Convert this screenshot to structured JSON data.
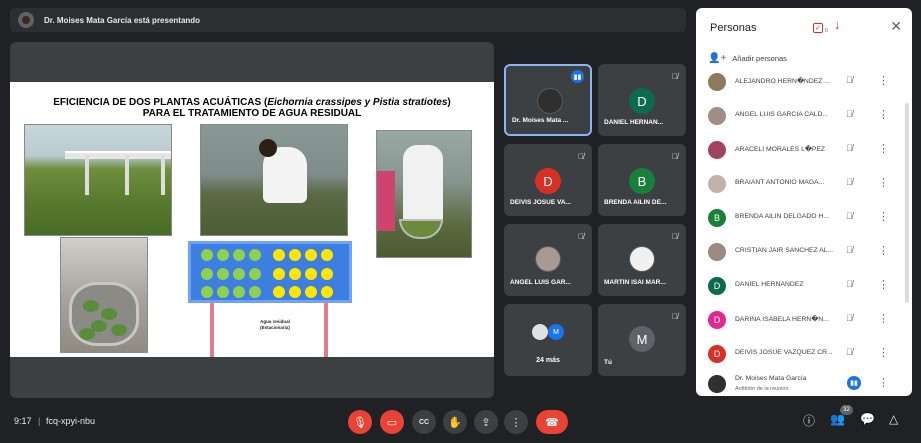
{
  "topbar": {
    "presenter_text": "Dr. Moises Mata García está presentando"
  },
  "slide": {
    "title_line1_prefix": "EFICIENCIA DE DOS PLANTAS ACUÁTICAS (",
    "title_line1_italic": "Eichornia crassipes y Pistia stratiotes",
    "title_line1_suffix": ")",
    "title_line2": "PARA EL TRATAMIENTO DE AGUA RESIDUAL",
    "diagram_label_line1": "Agua residual",
    "diagram_label_line2": "(Estacionaria)"
  },
  "tiles": [
    {
      "name": "Dr. Moises Mata ...",
      "kind": "photo",
      "status": "speaking"
    },
    {
      "name": "DANIEL HERNAN...",
      "kind": "letter",
      "letter": "D",
      "color": "#0b6b4f",
      "status": "muted"
    },
    {
      "name": "DEIVIS JOSUE VA...",
      "kind": "letter",
      "letter": "D",
      "color": "#d93025",
      "status": "muted"
    },
    {
      "name": "BRENDA AILIN DE...",
      "kind": "letter",
      "letter": "B",
      "color": "#188038",
      "status": "muted"
    },
    {
      "name": "ANGEL LUIS GAR...",
      "kind": "photo",
      "status": "muted"
    },
    {
      "name": "MARTIN ISAI MAR...",
      "kind": "photo",
      "status": "muted"
    },
    {
      "name": "24 más",
      "kind": "group",
      "status": "none"
    },
    {
      "name": "Tú",
      "kind": "letter",
      "letter": "M",
      "color": "#5f6368",
      "status": "muted"
    }
  ],
  "bottom": {
    "time": "9:17",
    "separator": "|",
    "meeting_code": "fcq-xpyi-nbu",
    "participants_badge": "32"
  },
  "people_panel": {
    "title": "Personas",
    "tasks_count": "0",
    "add_label": "Añadir personas",
    "people": [
      {
        "name": "ALEJANDRO HERN�NDEZ ...",
        "avatar": "photo",
        "letter": "",
        "color": "#8d7a5c"
      },
      {
        "name": "ANGEL LUIS GARCIA CALD...",
        "avatar": "photo",
        "letter": "",
        "color": "#9e8e86"
      },
      {
        "name": "ARACELI MORALES L�PEZ",
        "avatar": "photo",
        "letter": "",
        "color": "#a3445e"
      },
      {
        "name": "BRAIANT ANTONIO MAGA...",
        "avatar": "photo",
        "letter": "",
        "color": "#bfb3a6"
      },
      {
        "name": "BRENDA AILIN DELGADO H...",
        "avatar": "letter",
        "letter": "B",
        "color": "#188038"
      },
      {
        "name": "CRISTIAN JAIR SANCHEZ AL...",
        "avatar": "photo",
        "letter": "",
        "color": "#9a8a80"
      },
      {
        "name": "DANIEL HERNANDEZ",
        "avatar": "letter",
        "letter": "D",
        "color": "#0b6b4f"
      },
      {
        "name": "DARINA ISABELA HERN�N...",
        "avatar": "letter",
        "letter": "D",
        "color": "#e52592"
      },
      {
        "name": "DEIVIS JOSUE VAZQUEZ CR...",
        "avatar": "letter",
        "letter": "D",
        "color": "#d93025"
      }
    ],
    "host": {
      "name": "Dr. Moises Mata García",
      "subtitle": "Anfitrión de la reunión"
    }
  }
}
